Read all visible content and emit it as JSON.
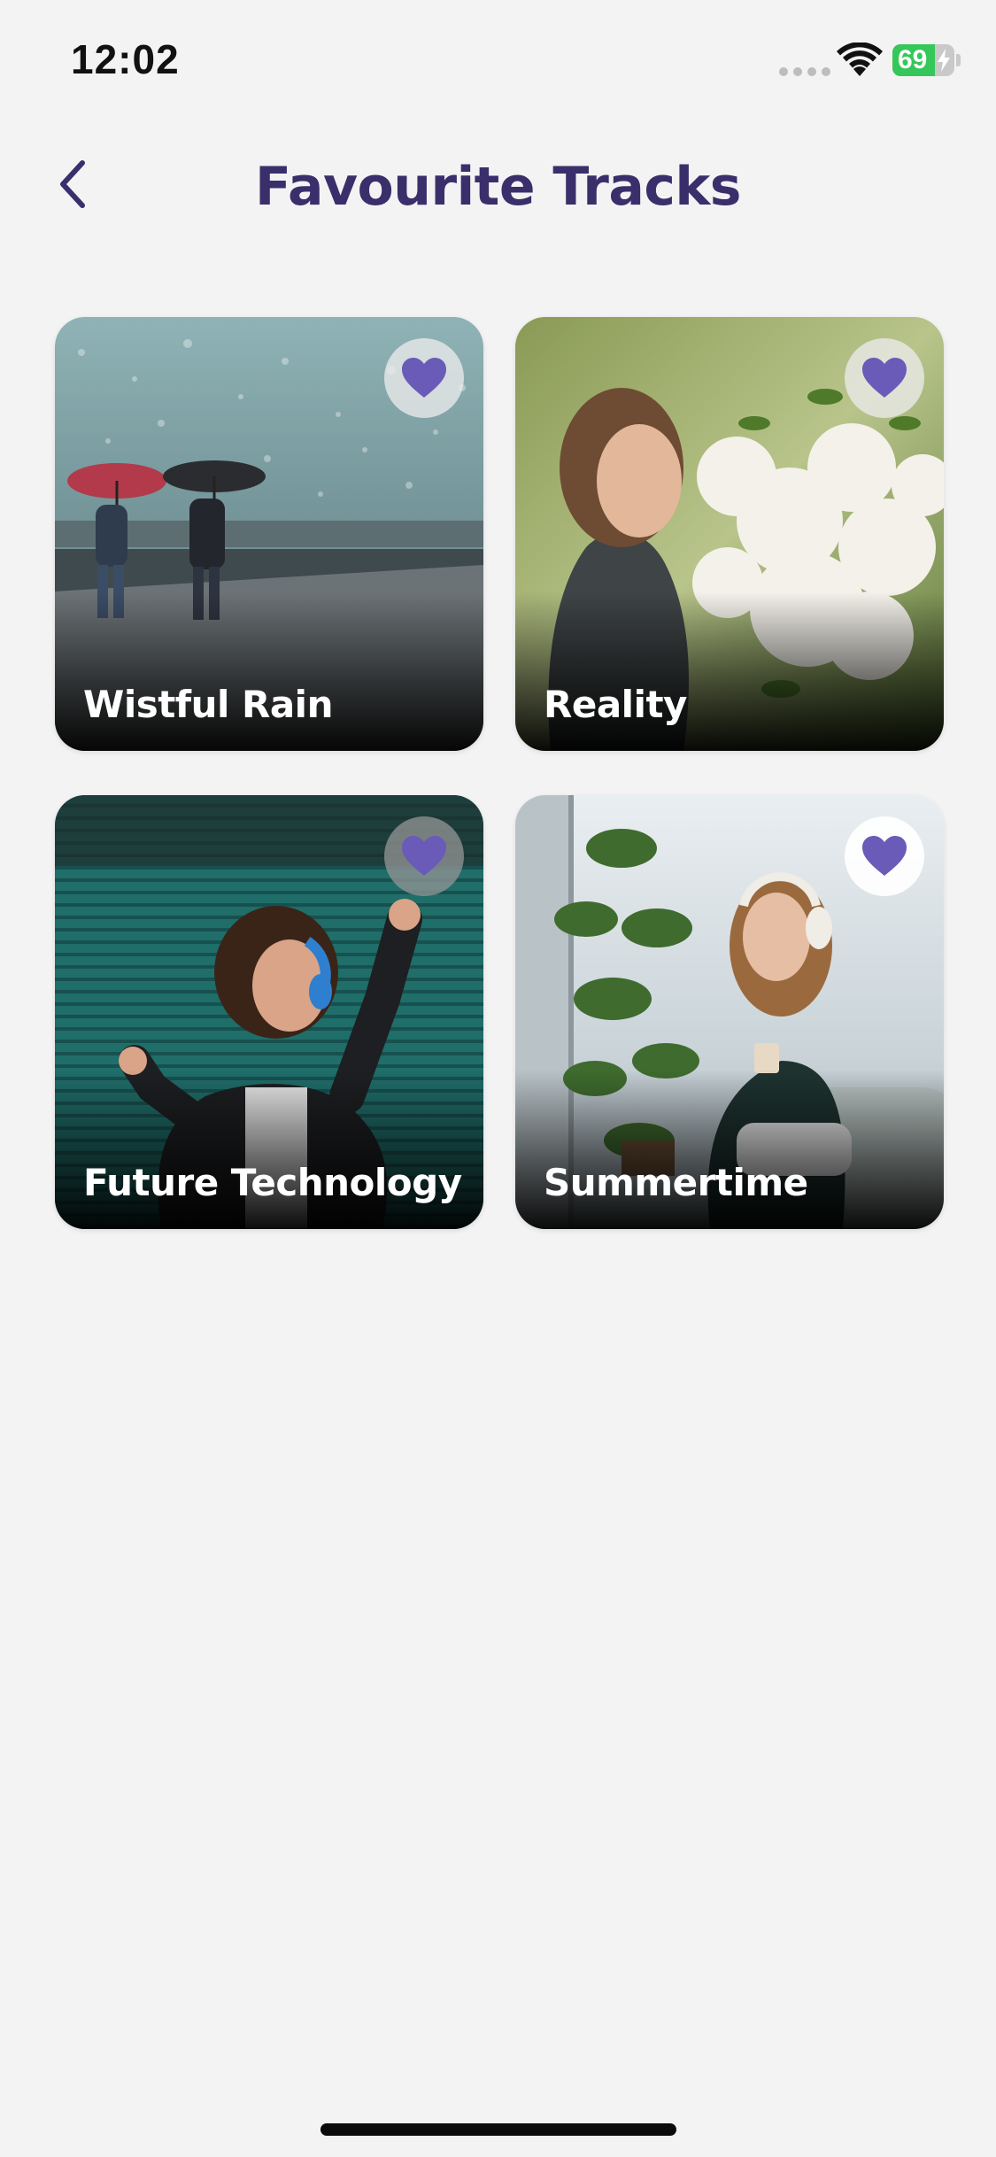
{
  "status_bar": {
    "time": "12:02",
    "battery_percent": 69,
    "battery_label": "69",
    "charging": true,
    "wifi_icon": "wifi-icon",
    "signal_icon": "cellular-signal-icon"
  },
  "header": {
    "title": "Favourite Tracks",
    "back_icon": "chevron-left-icon"
  },
  "colors": {
    "background": "#f3f3f3",
    "title": "#3a2f6b",
    "accent": "#6a5bb8",
    "battery_green": "#35c759"
  },
  "tracks": [
    {
      "title": "Wistful Rain",
      "favourite": true,
      "image": "rainy street with umbrellas"
    },
    {
      "title": "Reality",
      "favourite": true,
      "image": "woman smelling white blossoms"
    },
    {
      "title": "Future Technology",
      "favourite": true,
      "image": "woman dancing with headphones"
    },
    {
      "title": "Summertime",
      "favourite": true,
      "image": "woman with headphones and coffee"
    }
  ]
}
